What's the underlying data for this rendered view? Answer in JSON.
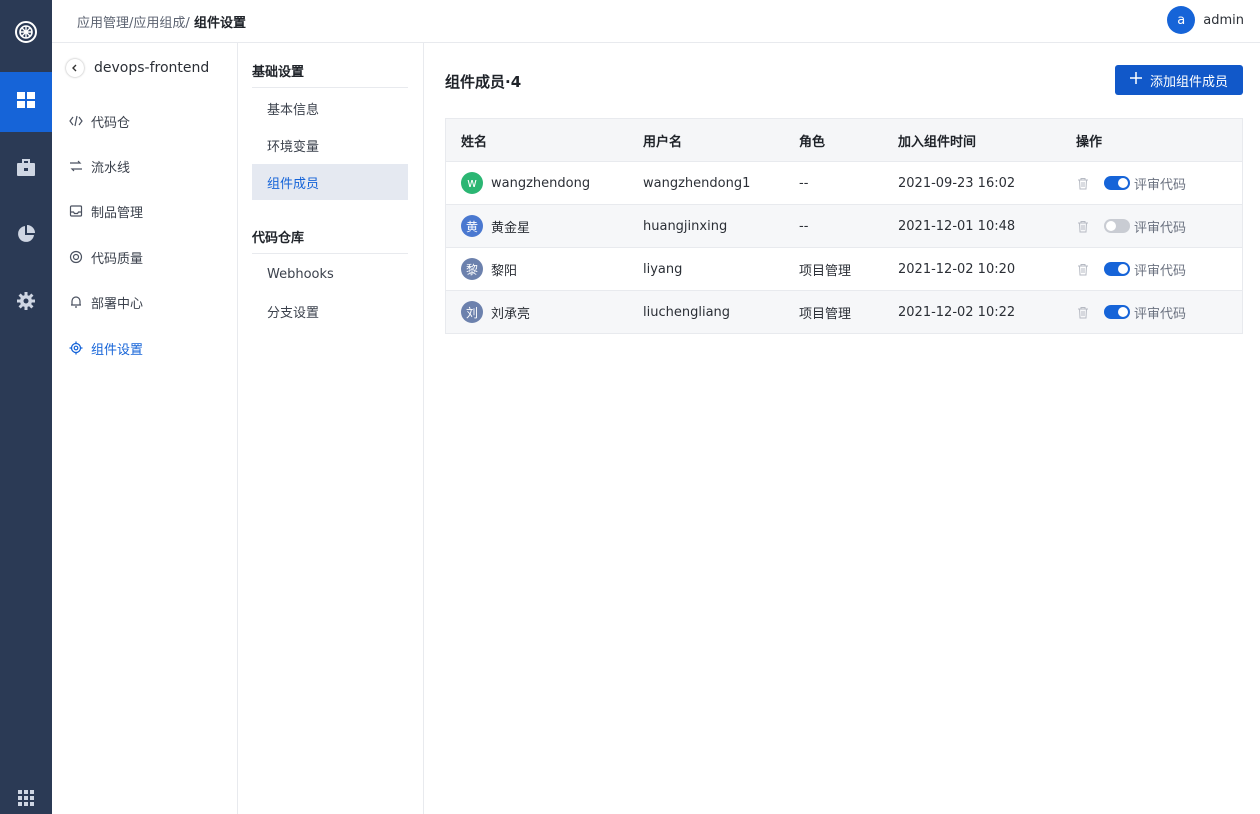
{
  "header": {
    "breadcrumb": [
      "应用管理",
      "应用组成"
    ],
    "separator": "/",
    "current": "组件设置",
    "user": {
      "initial": "a",
      "name": "admin"
    }
  },
  "rail": {
    "items": [
      "apps-grid-icon",
      "briefcase-icon",
      "pie-chart-icon",
      "gear-icon"
    ],
    "active_index": 0
  },
  "sidebar": {
    "project_name": "devops-frontend",
    "items": [
      {
        "label": "代码仓",
        "icon": "code-icon"
      },
      {
        "label": "流水线",
        "icon": "pipeline-icon"
      },
      {
        "label": "制品管理",
        "icon": "inbox-icon"
      },
      {
        "label": "代码质量",
        "icon": "quality-icon"
      },
      {
        "label": "部署中心",
        "icon": "bell-icon"
      },
      {
        "label": "组件设置",
        "icon": "settings-icon",
        "active": true
      }
    ]
  },
  "settings_menu": {
    "groups": [
      {
        "title": "基础设置",
        "items": [
          "基本信息",
          "环境变量",
          "组件成员"
        ]
      },
      {
        "title": "代码仓库",
        "items": [
          "Webhooks",
          "分支设置"
        ]
      }
    ],
    "active_item": "组件成员"
  },
  "main": {
    "title": "组件成员·4",
    "add_button": "添加组件成员",
    "columns": [
      "姓名",
      "用户名",
      "角色",
      "加入组件时间",
      "操作"
    ],
    "rows": [
      {
        "avatar": "w",
        "avatar_color": "#2bb673",
        "name": "wangzhendong",
        "username": "wangzhendong1",
        "role": "--",
        "joined": "2021-09-23 16:02",
        "review_on": true,
        "review_label": "评审代码"
      },
      {
        "avatar": "黄",
        "avatar_color": "#4a78d0",
        "name": "黄金星",
        "username": "huangjinxing",
        "role": "--",
        "joined": "2021-12-01 10:48",
        "review_on": false,
        "review_label": "评审代码"
      },
      {
        "avatar": "黎",
        "avatar_color": "#6c81ad",
        "name": "黎阳",
        "username": "liyang",
        "role": "项目管理",
        "joined": "2021-12-02 10:20",
        "review_on": true,
        "review_label": "评审代码"
      },
      {
        "avatar": "刘",
        "avatar_color": "#6c81ad",
        "name": "刘承亮",
        "username": "liuchengliang",
        "role": "项目管理",
        "joined": "2021-12-02 10:22",
        "review_on": true,
        "review_label": "评审代码"
      }
    ]
  },
  "colors": {
    "primary": "#1664d8",
    "rail": "#2b3a55"
  }
}
